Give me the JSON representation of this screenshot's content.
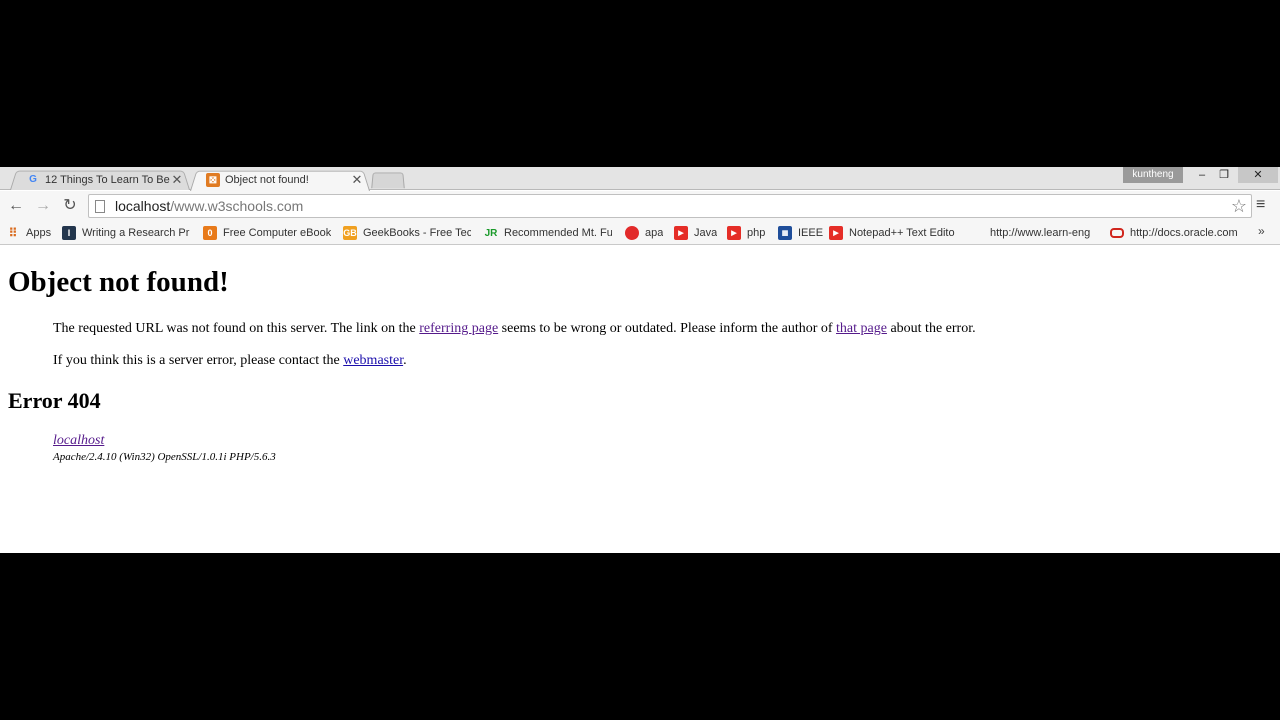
{
  "tabs": [
    {
      "title": "12 Things To Learn To Bec",
      "icon": "google-icon",
      "active": false
    },
    {
      "title": "Object not found!",
      "icon": "xampp-icon",
      "active": true
    }
  ],
  "profile_name": "kuntheng",
  "address_bar": {
    "host": "localhost",
    "path": "/www.w3schools.com"
  },
  "bookmarks": [
    {
      "label": "Apps",
      "icon": "apps-grid-icon"
    },
    {
      "label": "Writing a Research Pr",
      "icon": "bookmark-i-icon"
    },
    {
      "label": "Free Computer eBook",
      "icon": "bookmark-orange-icon"
    },
    {
      "label": "GeekBooks - Free Tec",
      "icon": "bookmark-gb-icon"
    },
    {
      "label": "Recommended Mt. Fu",
      "icon": "bookmark-jr-icon"
    },
    {
      "label": "apa",
      "icon": "bookmark-red-icon"
    },
    {
      "label": "Java",
      "icon": "youtube-icon"
    },
    {
      "label": "php",
      "icon": "youtube-icon"
    },
    {
      "label": "IEEE",
      "icon": "ieee-icon"
    },
    {
      "label": "Notepad++ Text Edito",
      "icon": "youtube-icon"
    },
    {
      "label": "http://www.learn-eng",
      "icon": "blank-icon"
    },
    {
      "label": "http://docs.oracle.com",
      "icon": "oracle-icon"
    }
  ],
  "page": {
    "heading": "Object not found!",
    "para1": {
      "text_before": "The requested URL was not found on this server. The link on the ",
      "link1": "referring page",
      "text_middle": " seems to be wrong or outdated. Please inform the author of ",
      "link2": "that page",
      "text_after": " about the error."
    },
    "para2": {
      "text_before": "If you think this is a server error, please contact the ",
      "link": "webmaster",
      "text_after": "."
    },
    "error_heading": "Error 404",
    "address_link": "localhost",
    "server_signature": "Apache/2.4.10 (Win32) OpenSSL/1.0.1i PHP/5.6.3"
  }
}
